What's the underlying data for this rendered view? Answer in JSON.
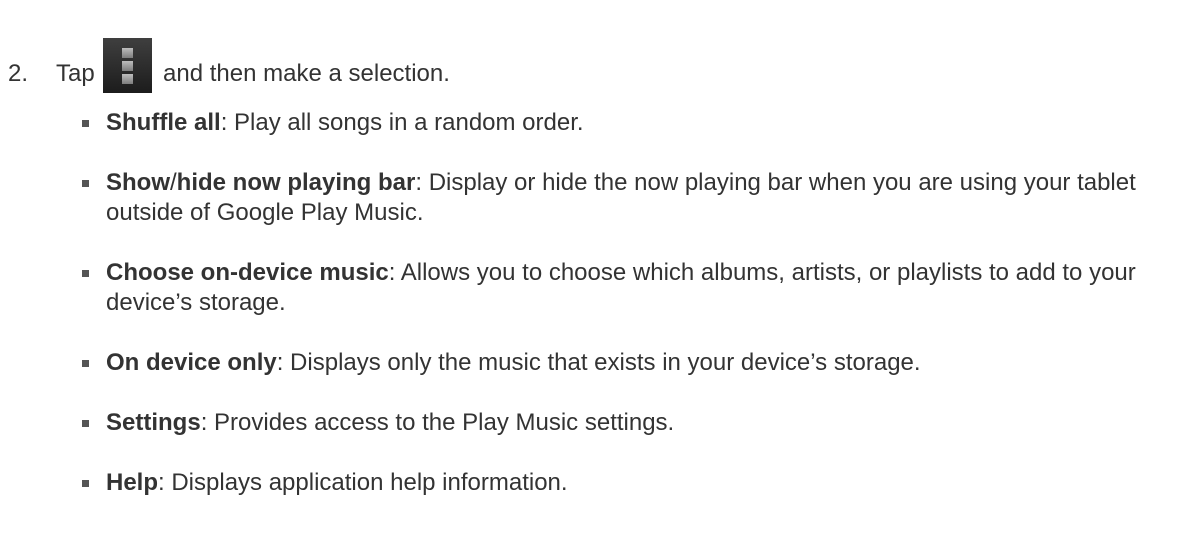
{
  "step": {
    "number": "2.",
    "text_before_icon": "Tap",
    "icon": "menu-icon",
    "text_after_icon": "and then make a selection."
  },
  "items": [
    {
      "term_prefix": "Shuffle all",
      "term_separator": "",
      "term_suffix": "",
      "description": ": Play all songs in a random order."
    },
    {
      "term_prefix": "Show",
      "term_separator": "/",
      "term_suffix": "hide now playing bar",
      "description": ": Display or hide the now playing bar when you are using your tablet outside of Google Play Music."
    },
    {
      "term_prefix": "Choose on-device music",
      "term_separator": "",
      "term_suffix": "",
      "description": ": Allows you to choose which albums, artists, or playlists to add to your device’s storage."
    },
    {
      "term_prefix": "On device only",
      "term_separator": "",
      "term_suffix": "",
      "description": ": Displays only the music that exists in your device’s storage."
    },
    {
      "term_prefix": "Settings",
      "term_separator": "",
      "term_suffix": "",
      "description": ": Provides access to the Play Music settings."
    },
    {
      "term_prefix": "Help",
      "term_separator": "",
      "term_suffix": "",
      "description": ": Displays application help information."
    }
  ]
}
